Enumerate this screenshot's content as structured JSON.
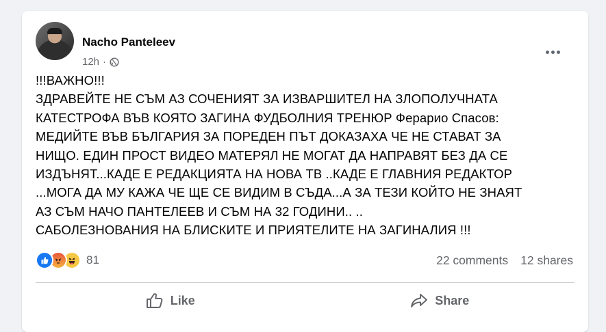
{
  "post": {
    "author": "Nacho Panteleev",
    "time": "12h",
    "separator": "·",
    "audience_icon": "globe-icon",
    "more_icon": "more-options-icon",
    "text_lines": [
      "!!!ВАЖНО!!!",
      "ЗДРАВЕЙТЕ НЕ СЪМ АЗ СОЧЕНИЯТ ЗА ИЗВАРШИТЕЛ НА ЗЛОПОЛУЧНАТА",
      "КАТЕСТРОФА ВЪВ КОЯТО ЗАГИНА ФУДБОЛНИЯ ТРЕНЮР Ферарио Спасов:",
      "МЕДИЙТЕ ВЪВ БЪЛГАРИЯ ЗА ПОРЕДЕН ПЪТ ДОКАЗАХА ЧЕ НЕ СТАВАТ ЗА",
      "НИЩО. ЕДИН ПРОСТ ВИДЕО МАТЕРЯЛ НЕ МОГАТ ДА НАПРАВЯТ БЕЗ ДА СЕ",
      "ИЗДЪНЯТ...КАДЕ Е РЕДАКЦИЯТА НА НОВА ТВ ..КАДЕ Е ГЛАВНИЯ РЕДАКТОР",
      "...МОГА ДА МУ КАЖА ЧЕ ЩЕ СЕ ВИДИМ В СЪДА...А ЗА ТЕЗИ КОЙТО НЕ ЗНАЯТ",
      "АЗ СЪМ НАЧО ПАНТЕЛЕЕВ И СЪМ НА 32 ГОДИНИ.. ..",
      "САБОЛЕЗНОВАНИЯ НА БЛИСКИТЕ И ПРИЯТЕЛИТЕ НА ЗАГИНАЛИЯ !!!"
    ]
  },
  "reactions": {
    "icons": [
      "like-reaction-icon",
      "angry-reaction-icon",
      "haha-reaction-icon"
    ],
    "count": "81",
    "comments": "22 comments",
    "shares": "12 shares"
  },
  "actions": {
    "like_label": "Like",
    "share_label": "Share"
  },
  "colors": {
    "like_blue": "#1877f2",
    "text": "#050505",
    "secondary": "#65676b",
    "background": "#f0f2f5"
  }
}
